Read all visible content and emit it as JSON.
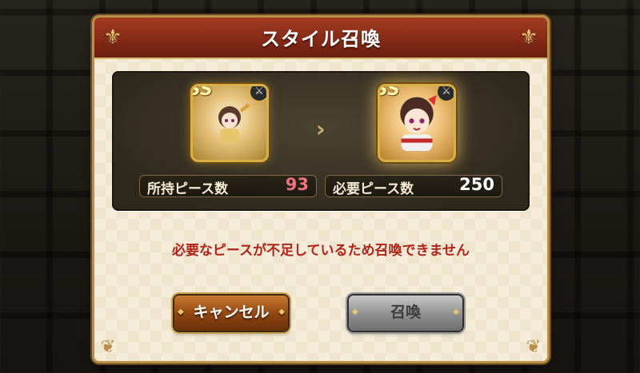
{
  "dialog": {
    "title": "スタイル召喚"
  },
  "cards": {
    "current": {
      "rank": "SS",
      "weapon_icon": "sword-icon"
    },
    "target": {
      "rank": "SS",
      "weapon_icon": "sword-icon"
    }
  },
  "counts": {
    "owned_label": "所持ピース数",
    "owned_value": "93",
    "required_label": "必要ピース数",
    "required_value": "250"
  },
  "message": "必要なピースが不足しているため召喚できません",
  "buttons": {
    "cancel_label": "キャンセル",
    "summon_label": "召喚"
  },
  "colors": {
    "header": "#7c2614",
    "message": "#b0241a",
    "owned_value": "#f0727f",
    "frame_gold": "#d9b045"
  }
}
